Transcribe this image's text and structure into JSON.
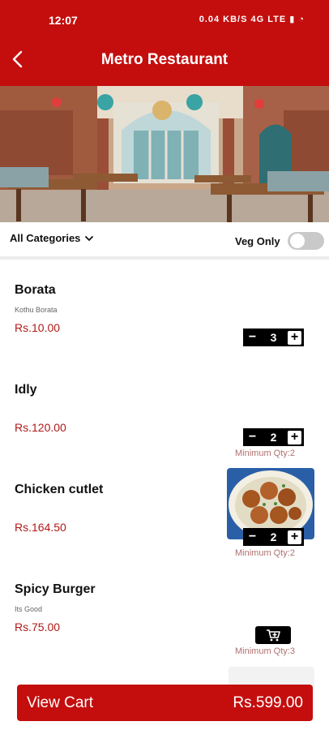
{
  "status_bar": {
    "time": "12:07",
    "indicators": "0.04 KB/S 4G LTE ▮ ◔"
  },
  "header": {
    "title": "Metro Restaurant",
    "back_icon": "chevron-left-icon"
  },
  "filters": {
    "category_label": "All Categories",
    "veg_only_label": "Veg Only",
    "veg_only_on": false
  },
  "colors": {
    "brand": "#c40e0e",
    "price": "#b01818",
    "min_qty": "#b07070"
  },
  "items": [
    {
      "name": "Borata",
      "description": "Kothu Borata",
      "price": "Rs.10.00",
      "quantity": "3",
      "min_qty": ""
    },
    {
      "name": "Idly",
      "description": "",
      "price": "Rs.120.00",
      "quantity": "2",
      "min_qty": "Minimum Qty:2"
    },
    {
      "name": "Chicken cutlet",
      "description": "",
      "price": "Rs.164.50",
      "quantity": "2",
      "min_qty": "Minimum Qty:2"
    },
    {
      "name": "Spicy Burger",
      "description": "Its Good",
      "price": "Rs.75.00",
      "quantity": "",
      "min_qty": "Minimum Qty:3"
    }
  ],
  "cart": {
    "label": "View Cart",
    "total": "Rs.599.00"
  }
}
